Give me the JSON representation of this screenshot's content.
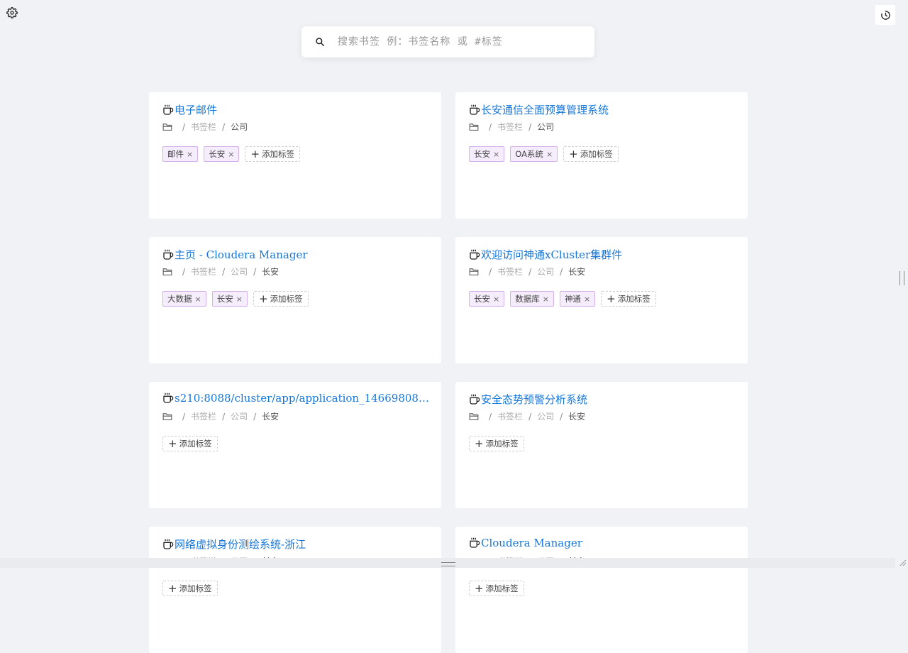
{
  "toolbar": {
    "settings_icon": "gear-icon",
    "history_icon": "history-clock-icon"
  },
  "search": {
    "placeholder": "搜索书签 例：书签名称 或 #标签",
    "value": ""
  },
  "add_tag_label": "添加标签",
  "cards": [
    {
      "title": "电子邮件",
      "path": [
        "书签栏",
        "公司"
      ],
      "tags": [
        "邮件",
        "长安"
      ]
    },
    {
      "title": "长安通信全面预算管理系统",
      "path": [
        "书签栏",
        "公司"
      ],
      "tags": [
        "长安",
        "OA系统"
      ]
    },
    {
      "title": "主页 - Cloudera Manager",
      "path": [
        "书签栏",
        "公司",
        "长安"
      ],
      "tags": [
        "大数据",
        "长安"
      ]
    },
    {
      "title": "欢迎访问神通xCluster集群件",
      "path": [
        "书签栏",
        "公司",
        "长安"
      ],
      "tags": [
        "长安",
        "数据库",
        "神通"
      ]
    },
    {
      "title": "s210:8088/cluster/app/application_146698082…",
      "path": [
        "书签栏",
        "公司",
        "长安"
      ],
      "tags": []
    },
    {
      "title": "安全态势预警分析系统",
      "path": [
        "书签栏",
        "公司",
        "长安"
      ],
      "tags": []
    },
    {
      "title": "网络虚拟身份测绘系统-浙江",
      "path": [
        "书签栏",
        "公司",
        "长安"
      ],
      "tags": []
    },
    {
      "title": "Cloudera Manager",
      "path": [
        "书签栏",
        "公司",
        "长安"
      ],
      "tags": []
    }
  ],
  "colors": {
    "link": "#1677d9",
    "tag_bg": "#f5edfb",
    "tag_border": "#d3b1ea",
    "page_bg": "#f0f2f5"
  }
}
